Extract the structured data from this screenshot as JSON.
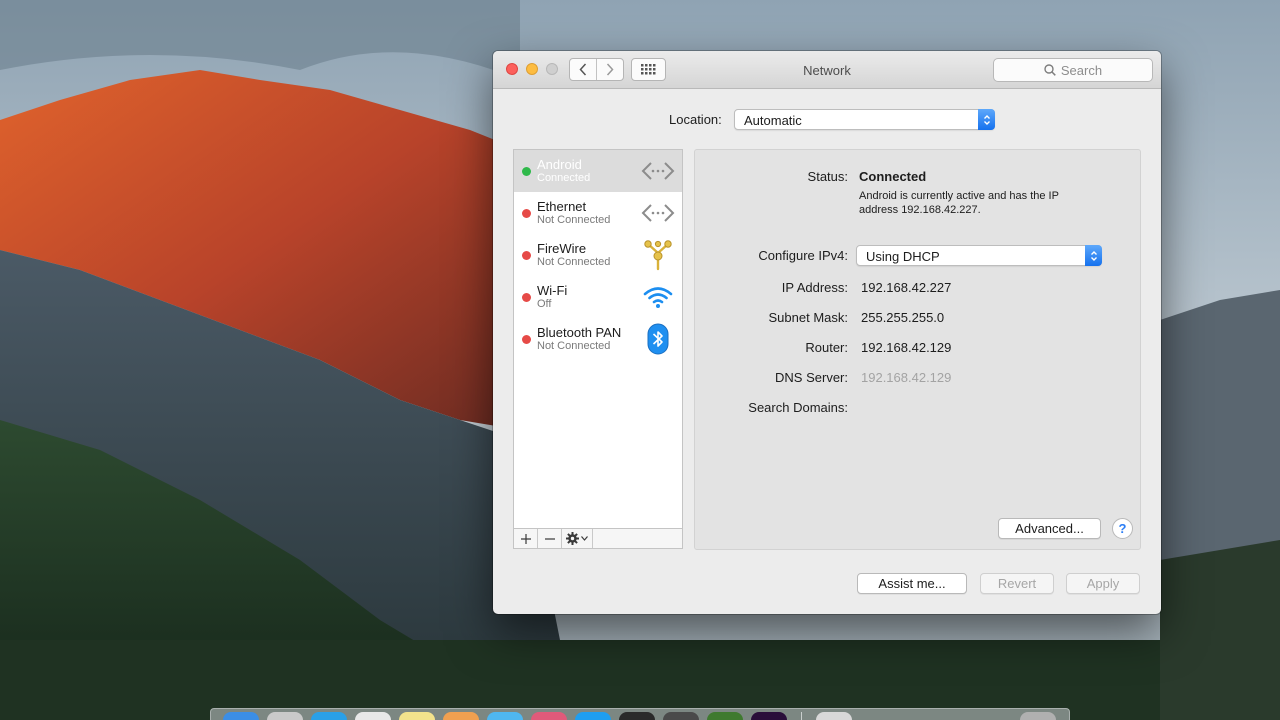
{
  "window": {
    "title": "Network"
  },
  "search": {
    "placeholder": "Search"
  },
  "location": {
    "label": "Location:",
    "value": "Automatic"
  },
  "services": [
    {
      "name": "Android",
      "status": "Connected",
      "dot": "#2fb94a",
      "icon": "ethernet-arrows-icon",
      "selected": true
    },
    {
      "name": "Ethernet",
      "status": "Not Connected",
      "dot": "#e64a47",
      "icon": "ethernet-arrows-icon",
      "selected": false
    },
    {
      "name": "FireWire",
      "status": "Not Connected",
      "dot": "#e64a47",
      "icon": "firewire-icon",
      "selected": false
    },
    {
      "name": "Wi-Fi",
      "status": "Off",
      "dot": "#e64a47",
      "icon": "wifi-icon",
      "selected": false
    },
    {
      "name": "Bluetooth PAN",
      "status": "Not Connected",
      "dot": "#e64a47",
      "icon": "bluetooth-icon",
      "selected": false
    }
  ],
  "list_toolbar": {
    "add": "+",
    "remove": "−"
  },
  "detail": {
    "status_label": "Status:",
    "status_value": "Connected",
    "status_desc": "Android is currently active and has the IP address 192.168.42.227.",
    "configure_label": "Configure IPv4:",
    "configure_value": "Using DHCP",
    "ip_label": "IP Address:",
    "ip_value": "192.168.42.227",
    "subnet_label": "Subnet Mask:",
    "subnet_value": "255.255.255.0",
    "router_label": "Router:",
    "router_value": "192.168.42.129",
    "dns_label": "DNS Server:",
    "dns_value": "192.168.42.129",
    "search_domains_label": "Search Domains:",
    "advanced_label": "Advanced...",
    "help_label": "?"
  },
  "footer": {
    "assist_label": "Assist me...",
    "revert_label": "Revert",
    "apply_label": "Apply"
  },
  "colors": {
    "accent": "#1571ee",
    "connected": "#2fb94a",
    "disconnected": "#e64a47",
    "wifi": "#1c8ef0"
  }
}
